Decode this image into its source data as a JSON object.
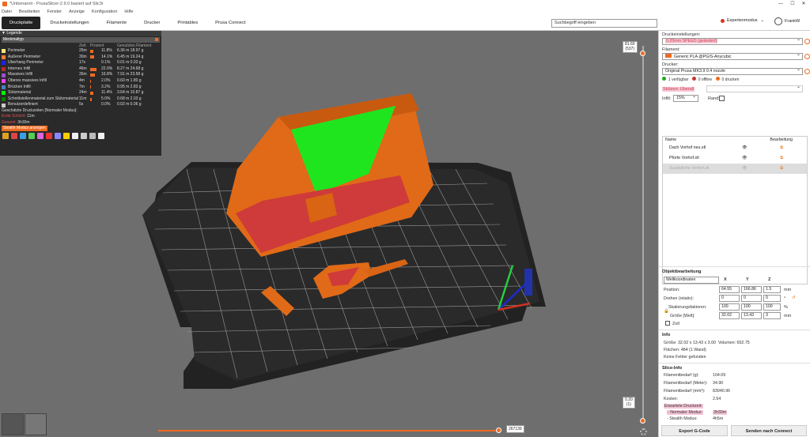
{
  "window": {
    "title": "*Unbenannt - PrusaSlicer-2.9.0 basiert auf Slic3r",
    "minimize": "—",
    "maximize": "☐",
    "close": "✕"
  },
  "menu": [
    "Datei",
    "Bearbeiten",
    "Fenster",
    "Anzeige",
    "Konfiguration",
    "Hilfe"
  ],
  "tabs": [
    "Druckplatte",
    "Druckeinstellungen",
    "Filamente",
    "Drucker",
    "Printables",
    "Prusa Connect"
  ],
  "search": {
    "placeholder": "Suchbegriff eingeben"
  },
  "mode": {
    "label": "Expertenmodus",
    "color": "#e0301e"
  },
  "user": {
    "name": "FrankW"
  },
  "legend": {
    "title": "Legende",
    "dropdown": "Merkmaltyp",
    "columns": [
      "",
      "Zeit",
      "Prozent",
      "Genutztes Filament"
    ],
    "rows": [
      {
        "color": "#ffe680",
        "name": "Perimeter",
        "time": "25m",
        "pct": "11.8%",
        "pct_val": 11.8,
        "fil": "6.36 m 18.97 g"
      },
      {
        "color": "#ff7d38",
        "name": "Äußerer Perimeter",
        "time": "30m",
        "pct": "14.1%",
        "pct_val": 14.1,
        "fil": "6.45 m 19.24 g"
      },
      {
        "color": "#1f1fff",
        "name": "Überhang Perimeter",
        "time": "17s",
        "pct": "0.1%",
        "pct_val": 0.1,
        "fil": "0.01 m 0.03 g"
      },
      {
        "color": "#b03029",
        "name": "Internes Infill",
        "time": "46m",
        "pct": "22.0%",
        "pct_val": 22.0,
        "fil": "8.27 m 24.68 g"
      },
      {
        "color": "#9654cc",
        "name": "Massives Infill",
        "time": "35m",
        "pct": "16.8%",
        "pct_val": 16.8,
        "fil": "7.91 m 23.58 g"
      },
      {
        "color": "#f140f1",
        "name": "Oberes massives Infill",
        "time": "4m",
        "pct": "2.0%",
        "pct_val": 2.0,
        "fil": "0.60 m 1.80 g"
      },
      {
        "color": "#4d80ba",
        "name": "Brücken Infill",
        "time": "7m",
        "pct": "3.2%",
        "pct_val": 3.2,
        "fil": "0.95 m 2.83 g"
      },
      {
        "color": "#00ff00",
        "name": "Stützmaterial",
        "time": "24m",
        "pct": "11.4%",
        "pct_val": 11.4,
        "fil": "3.64 m 10.87 g"
      },
      {
        "color": "#008000",
        "name": "Schnittstellenmaterial zum Stützmaterial",
        "time": "11m",
        "pct": "5.0%",
        "pct_val": 5.0,
        "fil": "0.68 m 2.03 g"
      },
      {
        "color": "#cccccc",
        "name": "Benutzerdefiniert",
        "time": "5s",
        "pct": "0.0%",
        "pct_val": 0.0,
        "fil": "0.02 m 0.06 g"
      }
    ],
    "est_title": "Geschätzte Druckzeiten [Normaler Modus]:",
    "first_layer_label": "Erste Schicht:",
    "first_layer": "11m",
    "total_label": "Gesamt:",
    "total": "3h30m",
    "stealth_btn": "Stealth Modus anzeigen"
  },
  "vslider": {
    "top_label": "81.60\n(537)",
    "bottom_label": "0.20\n(1)"
  },
  "hslider": {
    "label": "267139"
  },
  "right": {
    "print_settings_label": "Druckeinstellungen:",
    "print_settings_value": "0.20mm SPEED (geändert)",
    "filament_label": "Filament:",
    "filament_value": "Generic PLA @PGIS-Anycubic",
    "printer_label": "Drucker:",
    "printer_value": "Original Prusa MK3.9 0.4 nozzle",
    "avail": "1 verfügbar",
    "offline": "0 offline",
    "printing": "0 drucken",
    "supports_label": "Stützen:",
    "supports_value": "Überall",
    "infill_label": "Infill:",
    "infill_value": "15%",
    "brim_label": "Rand:",
    "obj_col_name": "Name",
    "obj_col_edit": "Bearbeitung",
    "objects": [
      "Dach Vorhof neu.stl",
      "Pforte Vorhof.stl",
      "Zusätzliche Vorhof.stl"
    ],
    "objedit_title": "Objektbearbeitung",
    "coord_select": "Weltkoordinaten",
    "axes": [
      "X",
      "Y",
      "Z"
    ],
    "position_label": "Position:",
    "position": [
      "64.55",
      "166.86",
      "1.5"
    ],
    "unit_mm": "mm",
    "rotate_label": "Drehen (relativ):",
    "rotate": [
      "0",
      "0",
      "0"
    ],
    "unit_deg": "°",
    "scale_label": "Skalierungsfaktoren:",
    "scale": [
      "100",
      "100",
      "100"
    ],
    "unit_pct": "%",
    "size_label": "Größe [Welt]:",
    "size": [
      "32.02",
      "13.43",
      "3"
    ],
    "zoll": "Zoll",
    "info_title": "Info",
    "info_size_label": "Größe:",
    "info_size": "32.02 x 13.43 x 3.00",
    "info_vol_label": "Volumen:",
    "info_vol": "652.75",
    "info_faces_label": "Flächen:",
    "info_faces": "484 (1 Wand)",
    "info_errors": "Keine Fehler gefunden",
    "slice_title": "Slice-Info",
    "slice_rows": [
      {
        "k": "Filamentbedarf (g):",
        "v": "104.09"
      },
      {
        "k": "Filamentbedarf (Meter):",
        "v": "34.90"
      },
      {
        "k": "Filamentbedarf (mm³):",
        "v": "83940.96"
      },
      {
        "k": "Kosten:",
        "v": "2.64"
      }
    ],
    "est_time_label": "Erwartete Druckzeit:",
    "normal_mode_label": "- Normaler Modus:",
    "normal_mode": "3h30m",
    "stealth_mode_label": "- Stealth Modus:",
    "stealth_mode": "4h5m",
    "export_btn": "Export G-Code",
    "send_btn": "Senden nach Connect"
  }
}
